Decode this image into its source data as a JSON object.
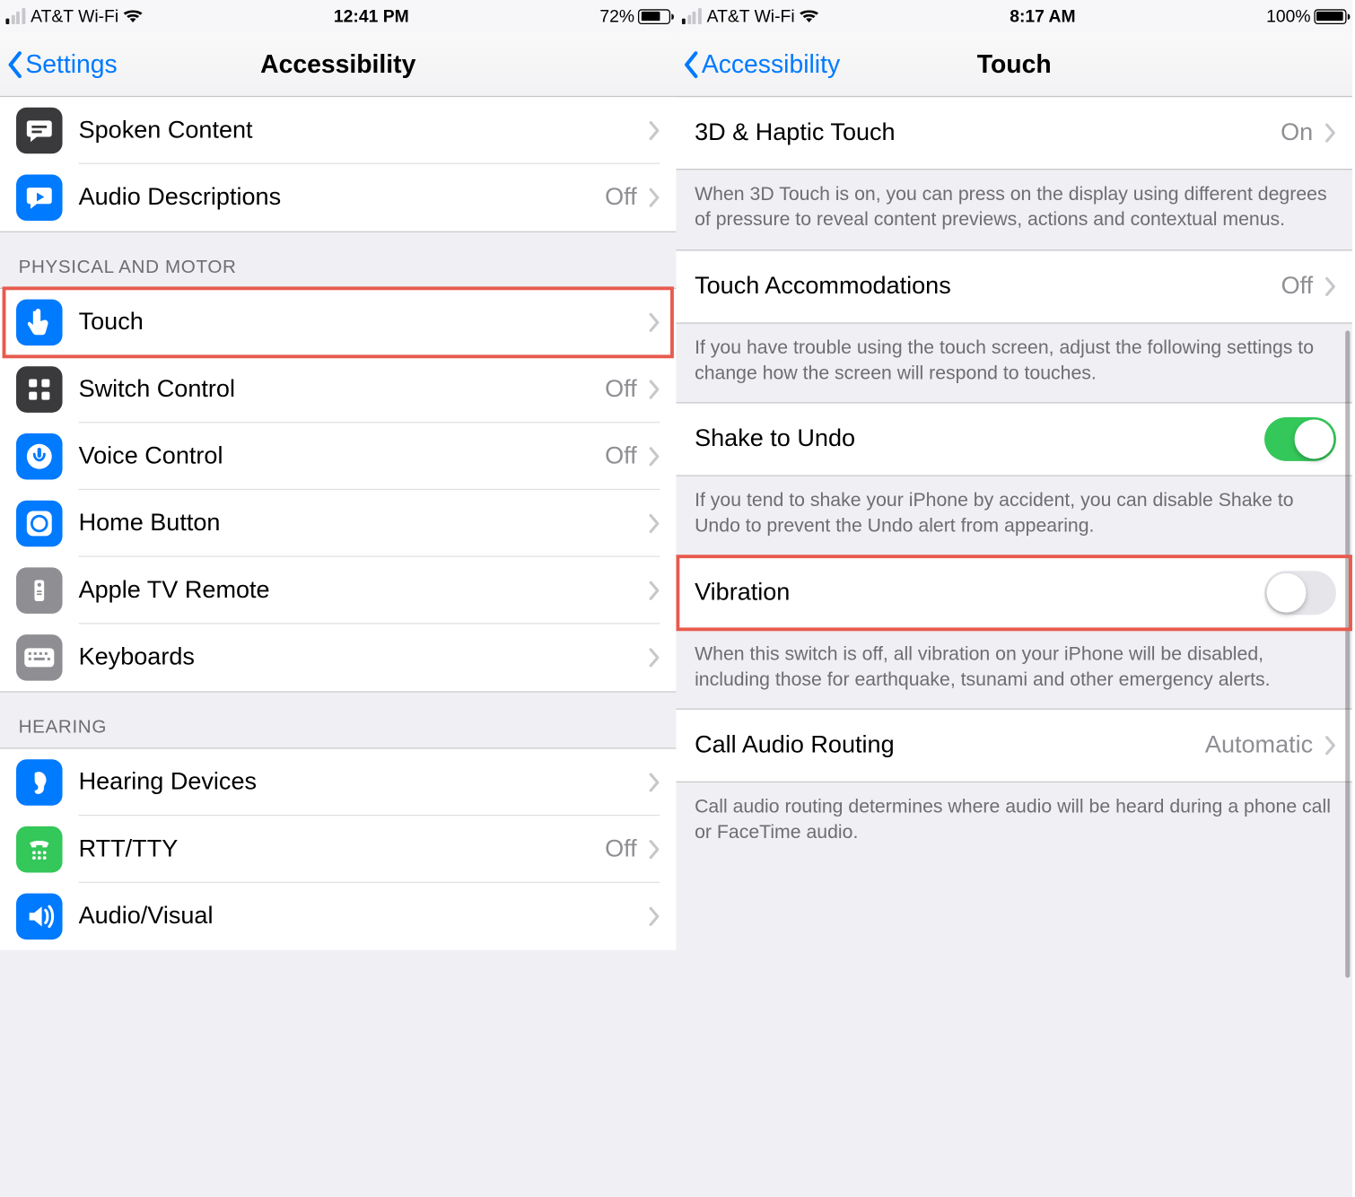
{
  "left": {
    "status": {
      "carrier": "AT&T Wi-Fi",
      "time": "12:41 PM",
      "battery_pct": "72%",
      "battery_fill": 72,
      "signal_bars_on": 1
    },
    "nav": {
      "back_label": "Settings",
      "title": "Accessibility"
    },
    "groups": {
      "top_rows": [
        {
          "name": "spoken-content",
          "label": "Spoken Content",
          "value": "",
          "icon": "speech-bubble-text-icon",
          "color": "ic-dark"
        },
        {
          "name": "audio-descriptions",
          "label": "Audio Descriptions",
          "value": "Off",
          "icon": "speech-bubble-play-icon",
          "color": "ic-blue"
        }
      ],
      "physical_header": "PHYSICAL AND MOTOR",
      "physical_rows": [
        {
          "name": "touch",
          "label": "Touch",
          "value": "",
          "icon": "touch-icon",
          "color": "ic-blue",
          "highlight": true
        },
        {
          "name": "switch-control",
          "label": "Switch Control",
          "value": "Off",
          "icon": "grid-icon",
          "color": "ic-dark"
        },
        {
          "name": "voice-control",
          "label": "Voice Control",
          "value": "Off",
          "icon": "voice-icon",
          "color": "ic-blue"
        },
        {
          "name": "home-button",
          "label": "Home Button",
          "value": "",
          "icon": "home-circle-icon",
          "color": "ic-blue"
        },
        {
          "name": "apple-tv-remote",
          "label": "Apple TV Remote",
          "value": "",
          "icon": "remote-icon",
          "color": "ic-gray"
        },
        {
          "name": "keyboards",
          "label": "Keyboards",
          "value": "",
          "icon": "keyboard-icon",
          "color": "ic-gray"
        }
      ],
      "hearing_header": "HEARING",
      "hearing_rows": [
        {
          "name": "hearing-devices",
          "label": "Hearing Devices",
          "value": "",
          "icon": "ear-icon",
          "color": "ic-blue"
        },
        {
          "name": "rtt-tty",
          "label": "RTT/TTY",
          "value": "Off",
          "icon": "tty-icon",
          "color": "ic-green"
        },
        {
          "name": "audio-visual",
          "label": "Audio/Visual",
          "value": "",
          "icon": "speaker-icon",
          "color": "ic-blue"
        }
      ]
    }
  },
  "right": {
    "status": {
      "carrier": "AT&T Wi-Fi",
      "time": "8:17 AM",
      "battery_pct": "100%",
      "battery_fill": 100,
      "signal_bars_on": 1
    },
    "nav": {
      "back_label": "Accessibility",
      "title": "Touch"
    },
    "rows": {
      "haptic": {
        "label": "3D & Haptic Touch",
        "value": "On"
      },
      "haptic_footer": "When 3D Touch is on, you can press on the display using different degrees of pressure to reveal content previews, actions and contextual menus.",
      "accom": {
        "label": "Touch Accommodations",
        "value": "Off"
      },
      "accom_footer": "If you have trouble using the touch screen, adjust the following settings to change how the screen will respond to touches.",
      "shake": {
        "label": "Shake to Undo",
        "on": true
      },
      "shake_footer": "If you tend to shake your iPhone by accident, you can disable Shake to Undo to prevent the Undo alert from appearing.",
      "vibration": {
        "label": "Vibration",
        "on": false,
        "highlight": true
      },
      "vibration_footer": "When this switch is off, all vibration on your iPhone will be disabled, including those for earthquake, tsunami and other emergency alerts.",
      "call_routing": {
        "label": "Call Audio Routing",
        "value": "Automatic"
      },
      "call_routing_footer": "Call audio routing determines where audio will be heard during a phone call or FaceTime audio."
    }
  }
}
